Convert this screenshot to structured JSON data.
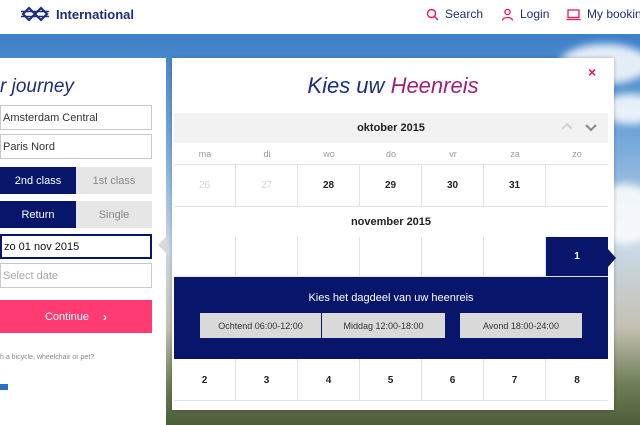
{
  "header": {
    "brand": "International",
    "nav": {
      "search": "Search",
      "login": "Login",
      "bookings": "My bookings"
    },
    "icons": {
      "search": "search-icon",
      "login": "user-icon",
      "bookings": "laptop-icon"
    }
  },
  "form": {
    "title": "r journey",
    "from": "Amsterdam Central",
    "to": "Paris Nord",
    "class_options": [
      "2nd class",
      "1st class"
    ],
    "selected_class": "2nd class",
    "trip_options": [
      "Return",
      "Single"
    ],
    "selected_trip": "Return",
    "departure_value": "zo 01 nov 2015",
    "return_placeholder": "Select date",
    "continue_label": "Continue",
    "extra_text": "h a bicycle, wheelchair or pet?"
  },
  "modal": {
    "title_part1": "Kies uw",
    "title_part2": "Heenreis",
    "close_label": "×",
    "month1": "oktober 2015",
    "weekdays": [
      "ma",
      "di",
      "wo",
      "do",
      "vr",
      "za",
      "zo"
    ],
    "month1_row": [
      "26",
      "27",
      "28",
      "29",
      "30",
      "31",
      ""
    ],
    "month2": "november 2015",
    "month2_first_row": [
      "",
      "",
      "",
      "",
      "",
      "",
      "1"
    ],
    "selected_date": "1",
    "dagdeel_title": "Kies het dagdeel van uw heenreis",
    "dagdeel_options": [
      "Ochtend 06:00-12:00",
      "Middag 12:00-18:00",
      "Avond 18:00-24:00"
    ],
    "month2_second_row": [
      "2",
      "3",
      "4",
      "5",
      "6",
      "7",
      "8"
    ]
  },
  "colors": {
    "navy": "#07166b",
    "brand_blue": "#1d2f7a",
    "pink": "#ff3b72",
    "heenreis": "#a3207a",
    "close": "#e8185b"
  }
}
